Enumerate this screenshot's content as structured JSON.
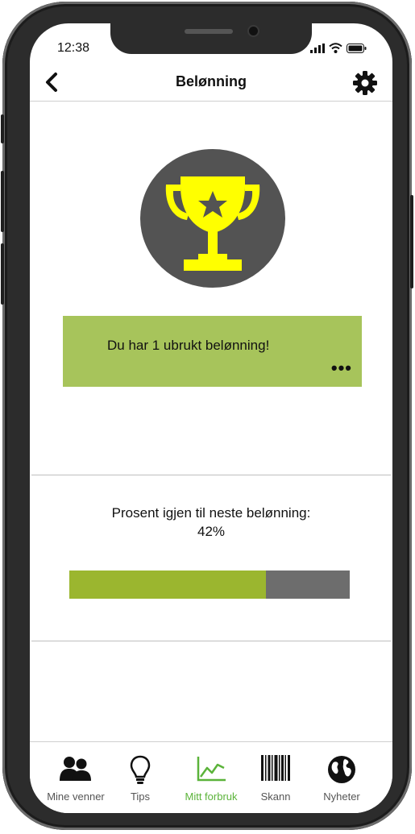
{
  "status_bar": {
    "time": "12:38"
  },
  "header": {
    "title": "Belønning"
  },
  "reward": {
    "message": "Du har 1 ubrukt belønning!",
    "more_label": "•••"
  },
  "progress": {
    "label": "Prosent igjen til neste belønning:",
    "value_text": "42%",
    "fill_fraction": 0.7
  },
  "colors": {
    "accent_green": "#a7c45b",
    "progress_green": "#9bb62f",
    "trophy_yellow": "#ffff00",
    "active_tab": "#5bb33a"
  },
  "tabs": [
    {
      "label": "Mine venner",
      "icon": "friends-icon",
      "active": false
    },
    {
      "label": "Tips",
      "icon": "lightbulb-icon",
      "active": false
    },
    {
      "label": "Mitt forbruk",
      "icon": "chart-icon",
      "active": true
    },
    {
      "label": "Skann",
      "icon": "barcode-icon",
      "active": false
    },
    {
      "label": "Nyheter",
      "icon": "globe-icon",
      "active": false
    }
  ]
}
